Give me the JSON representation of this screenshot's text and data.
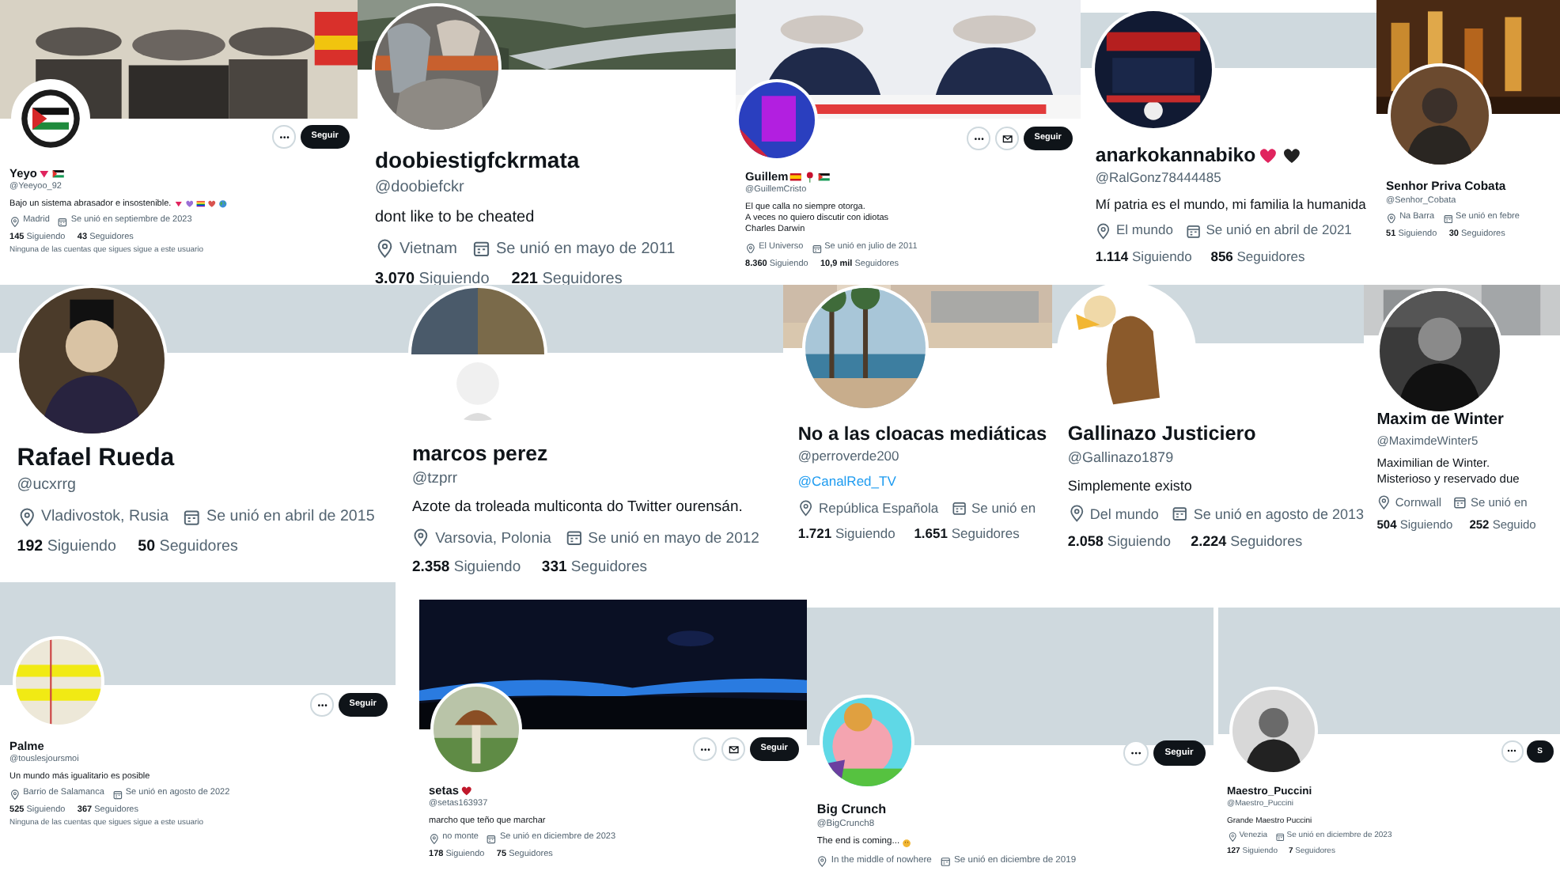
{
  "profiles": [
    {
      "banner": {
        "kind": "picture"
      },
      "avatar": {
        "kind": "picture"
      },
      "actions": [
        {
          "kind": "more"
        },
        {
          "kind": "follow",
          "label": "Seguir"
        }
      ],
      "name": "Yeyo",
      "name_icons": [
        {
          "kind": "triangle",
          "color": "#e0245e"
        },
        {
          "kind": "flag-ps"
        }
      ],
      "handle": "@Yeeyoo_92",
      "bio": [
        "Bajo un sistema abrasador e insostenible."
      ],
      "bio_icons": [
        {
          "kind": "triangle",
          "color": "#e0245e"
        },
        {
          "kind": "heart",
          "color": "#9b6fd6"
        },
        {
          "kind": "flag-rainbow"
        },
        {
          "kind": "heart",
          "color": "#d9534f"
        },
        {
          "kind": "globe"
        }
      ],
      "location": "Madrid",
      "joined": "Se unió en septiembre de 2023",
      "following": {
        "count": "145",
        "label": "Siguiendo"
      },
      "followers": {
        "count": "43",
        "label": "Seguidores"
      },
      "note": "Ninguna de las cuentas que sigues sigue a este usuario"
    },
    {
      "banner": {
        "kind": "picture"
      },
      "avatar": {
        "kind": "picture"
      },
      "name": "doobiestigfckrmata",
      "handle": "@doobiefckr",
      "bio": [
        "dont like to be cheated"
      ],
      "location": "Vietnam",
      "joined": "Se unió en mayo de 2011",
      "following": {
        "count": "3.070",
        "label": "Siguiendo"
      },
      "followers": {
        "count": "221",
        "label": "Seguidores"
      }
    },
    {
      "banner": {
        "kind": "picture"
      },
      "avatar": {
        "kind": "picture"
      },
      "actions": [
        {
          "kind": "more"
        },
        {
          "kind": "mail"
        },
        {
          "kind": "follow",
          "label": "Seguir"
        }
      ],
      "name": "Guillem",
      "name_icons": [
        {
          "kind": "flag-es"
        },
        {
          "kind": "rose"
        },
        {
          "kind": "flag-ps"
        }
      ],
      "handle": "@GuillemCristo",
      "bio": [
        "El que calla no siempre otorga.",
        "A veces no quiero discutir con idiotas",
        "Charles Darwin"
      ],
      "location": "El Universo",
      "joined": "Se unió en julio de 2011",
      "following": {
        "count": "8.360",
        "label": "Siguiendo"
      },
      "followers": {
        "count": "10,9 mil",
        "label": "Seguidores"
      }
    },
    {
      "banner": {
        "kind": "plain"
      },
      "avatar": {
        "kind": "picture"
      },
      "name": "anarkokannabiko",
      "name_icons": [
        {
          "kind": "heart",
          "color": "#e0245e"
        },
        {
          "kind": "heart",
          "color": "#222222"
        }
      ],
      "handle": "@RalGonz78444485",
      "bio": [
        "Mí patria es el mundo, mi familia la humanida"
      ],
      "location": "El mundo",
      "joined": "Se unió en abril de 2021",
      "following": {
        "count": "1.114",
        "label": "Siguiendo"
      },
      "followers": {
        "count": "856",
        "label": "Seguidores"
      }
    },
    {
      "banner": {
        "kind": "picture"
      },
      "avatar": {
        "kind": "picture"
      },
      "name": "Senhor Priva Cobata",
      "handle": "@Senhor_Cobata",
      "location": "Na Barra",
      "joined": "Se unió en febre",
      "following": {
        "count": "51",
        "label": "Siguiendo"
      },
      "followers": {
        "count": "30",
        "label": "Seguidores"
      }
    },
    {
      "banner": {
        "kind": "plain"
      },
      "avatar": {
        "kind": "picture"
      },
      "name": "Rafael Rueda",
      "handle": "@ucxrrg",
      "location": "Vladivostok, Rusia",
      "joined": "Se unió en abril de 2015",
      "following": {
        "count": "192",
        "label": "Siguiendo"
      },
      "followers": {
        "count": "50",
        "label": "Seguidores"
      }
    },
    {
      "banner": {
        "kind": "plain"
      },
      "avatar": {
        "kind": "picture"
      },
      "name": "marcos perez",
      "handle": "@tzprr",
      "bio": [
        "Azote da troleada multiconta do Twitter ourensán."
      ],
      "location": "Varsovia, Polonia",
      "joined": "Se unió en mayo de 2012",
      "following": {
        "count": "2.358",
        "label": "Siguiendo"
      },
      "followers": {
        "count": "331",
        "label": "Seguidores"
      }
    },
    {
      "banner": {
        "kind": "picture"
      },
      "avatar": {
        "kind": "picture"
      },
      "name": "No a las cloacas mediáticas",
      "handle": "@perroverde200",
      "link": "@CanalRed_TV",
      "location": "República Española",
      "joined": "Se unió en",
      "following": {
        "count": "1.721",
        "label": "Siguiendo"
      },
      "followers": {
        "count": "1.651",
        "label": "Seguidores"
      }
    },
    {
      "banner": {
        "kind": "plain"
      },
      "avatar": {
        "kind": "picture"
      },
      "name": "Gallinazo Justiciero",
      "handle": "@Gallinazo1879",
      "bio": [
        "Simplemente existo"
      ],
      "location": "Del mundo",
      "joined": "Se unió en agosto de 2013",
      "following": {
        "count": "2.058",
        "label": "Siguiendo"
      },
      "followers": {
        "count": "2.224",
        "label": "Seguidores"
      }
    },
    {
      "banner": {
        "kind": "picture"
      },
      "avatar": {
        "kind": "picture"
      },
      "name": "Maxim de Winter",
      "handle": "@MaximdeWinter5",
      "bio": [
        "Maximilian de Winter.",
        "Misterioso y reservado due"
      ],
      "location": "Cornwall",
      "joined": "Se unió en",
      "following": {
        "count": "504",
        "label": "Siguiendo"
      },
      "followers": {
        "count": "252",
        "label": "Seguido"
      }
    },
    {
      "banner": {
        "kind": "plain"
      },
      "avatar": {
        "kind": "picture"
      },
      "actions": [
        {
          "kind": "more"
        },
        {
          "kind": "follow",
          "label": "Seguir"
        }
      ],
      "name": "Palme",
      "handle": "@touslesjoursmoi",
      "bio": [
        "Un mundo más igualitario es posible"
      ],
      "location": "Barrio de Salamanca",
      "joined": "Se unió en agosto de 2022",
      "following": {
        "count": "525",
        "label": "Siguiendo"
      },
      "followers": {
        "count": "367",
        "label": "Seguidores"
      },
      "note": "Ninguna de las cuentas que sigues sigue a este usuario"
    },
    {
      "banner": {
        "kind": "picture"
      },
      "avatar": {
        "kind": "picture"
      },
      "actions": [
        {
          "kind": "more"
        },
        {
          "kind": "mail"
        },
        {
          "kind": "follow",
          "label": "Seguir"
        }
      ],
      "name": "setas",
      "name_icons": [
        {
          "kind": "heart",
          "color": "#c0182b"
        }
      ],
      "handle": "@setas163937",
      "bio": [
        "marcho que teño que marchar"
      ],
      "location": "no monte",
      "joined": "Se unió en diciembre de 2023",
      "following": {
        "count": "178",
        "label": "Siguiendo"
      },
      "followers": {
        "count": "75",
        "label": "Seguidores"
      }
    },
    {
      "banner": {
        "kind": "plain"
      },
      "avatar": {
        "kind": "picture"
      },
      "actions": [
        {
          "kind": "more"
        },
        {
          "kind": "follow",
          "label": "Seguir"
        }
      ],
      "name": "Big Crunch",
      "handle": "@BigCrunch8",
      "bio": [
        "The end is coming..."
      ],
      "bio_icons": [
        {
          "kind": "face",
          "color": "#f2b632"
        }
      ],
      "location": "In the middle of nowhere",
      "joined": "Se unió en diciembre de 2019"
    },
    {
      "banner": {
        "kind": "plain"
      },
      "avatar": {
        "kind": "picture"
      },
      "actions": [
        {
          "kind": "more"
        },
        {
          "kind": "follow",
          "label": "S"
        }
      ],
      "name": "Maestro_Puccini",
      "handle": "@Maestro_Puccini",
      "bio": [
        "Grande Maestro Puccini"
      ],
      "location": "Venezia",
      "joined": "Se unió en diciembre de 2023",
      "following": {
        "count": "127",
        "label": "Siguiendo"
      },
      "followers": {
        "count": "7",
        "label": "Seguidores"
      }
    }
  ]
}
